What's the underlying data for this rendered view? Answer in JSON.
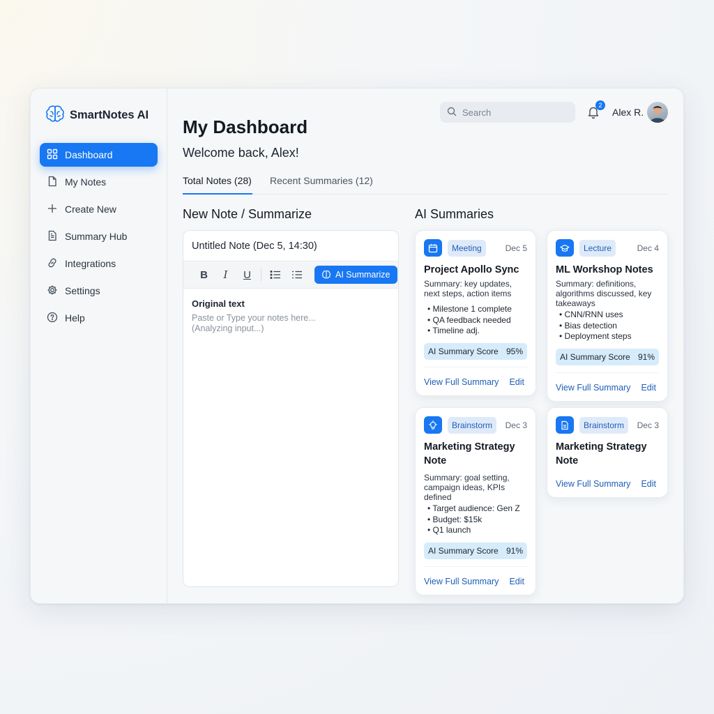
{
  "app": {
    "name": "SmartNotes AI"
  },
  "sidebar": {
    "items": [
      {
        "label": "Dashboard",
        "icon": "dashboard-icon",
        "active": true
      },
      {
        "label": "My Notes",
        "icon": "note-icon"
      },
      {
        "label": "Create New",
        "icon": "plus-icon"
      },
      {
        "label": "Summary Hub",
        "icon": "document-icon"
      },
      {
        "label": "Integrations",
        "icon": "link-icon"
      },
      {
        "label": "Settings",
        "icon": "gear-icon"
      },
      {
        "label": "Help",
        "icon": "help-icon"
      }
    ]
  },
  "header": {
    "search_placeholder": "Search",
    "notification_count": "2",
    "user_name": "Alex R."
  },
  "main": {
    "title": "My Dashboard",
    "welcome": "Welcome back, Alex!",
    "tabs": [
      {
        "label": "Total Notes (28)",
        "active": true
      },
      {
        "label": "Recent Summaries (12)"
      }
    ]
  },
  "editor": {
    "section_title": "New Note / Summarize",
    "note_title": "Untitled Note (Dec 5, 14:30)",
    "toolbar": {
      "bold": "B",
      "italic": "I",
      "underline": "U",
      "ai_button": "AI Summarize"
    },
    "original_label": "Original text",
    "placeholder_line1": "Paste or Type your notes here...",
    "placeholder_line2": "(Analyzing input...)"
  },
  "summaries": {
    "section_title": "AI Summaries",
    "score_label": "AI Summary Score",
    "view_label": "View Full Summary",
    "edit_label": "Edit",
    "cards": [
      {
        "tag": "Meeting",
        "date": "Dec 5",
        "icon": "calendar-icon",
        "title": "Project Apollo Sync",
        "summary": "Summary: key updates, next steps, action items",
        "bullets": [
          "Milestone 1 complete",
          "QA feedback needed",
          "Timeline adj."
        ],
        "score": "95%"
      },
      {
        "tag": "Lecture",
        "date": "Dec 4",
        "icon": "graduation-cap-icon",
        "title": "ML Workshop Notes",
        "summary": "Summary: definitions, algorithms discussed, key takeaways",
        "bullets": [
          "CNN/RNN uses",
          "Bias detection",
          "Deployment steps"
        ],
        "score": "91%"
      },
      {
        "tag": "Brainstorm",
        "date": "Dec 3",
        "icon": "lightbulb-icon",
        "title": "Marketing Strategy Note",
        "summary": "Summary: goal setting, campaign ideas, KPIs defined",
        "bullets": [
          "Target audience: Gen Z",
          "Budget: $15k",
          "Q1 launch"
        ],
        "score": "91%"
      },
      {
        "tag": "Brainstorm",
        "date": "Dec 3",
        "icon": "document-icon",
        "title": "Marketing Strategy Note"
      }
    ]
  }
}
